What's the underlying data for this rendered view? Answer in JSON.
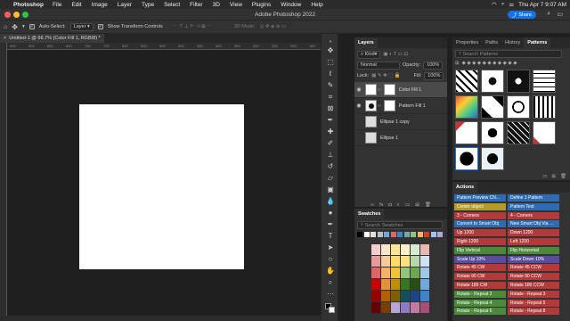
{
  "menubar": {
    "app": "Photoshop",
    "items": [
      "File",
      "Edit",
      "Image",
      "Layer",
      "Type",
      "Select",
      "Filter",
      "3D",
      "View",
      "Plugins",
      "Window",
      "Help"
    ],
    "datetime": "Thu Apr 7  9:07 AM"
  },
  "window": {
    "title": "Adobe Photoshop 2022",
    "share_label": "Share"
  },
  "options": {
    "auto_select_label": "Auto-Select:",
    "auto_select_value": "Layer",
    "show_transform_label": "Show Transform Controls",
    "mode_3d": "3D Mode:"
  },
  "document": {
    "tab_title": "Untitled-1 @ 66.7% (Color Fill 1, RGB/8) *"
  },
  "ruler": {
    "ticks": [
      "950",
      "900",
      "850",
      "800",
      "750",
      "700",
      "650",
      "600",
      "550",
      "500",
      "450",
      "400",
      "350",
      "300",
      "250",
      "200",
      "150"
    ]
  },
  "layers_panel": {
    "tabs": [
      "Layers",
      "Channels",
      "Paths"
    ],
    "kind_label": "Kind",
    "blend_mode": "Normal",
    "opacity_label": "Opacity:",
    "opacity_value": "100%",
    "lock_label": "Lock:",
    "fill_label": "Fill:",
    "fill_value": "100%",
    "layers": [
      {
        "name": "Color Fill 1",
        "visible": true
      },
      {
        "name": "Pattern Fill 1",
        "visible": true
      },
      {
        "name": "Ellipse 1 copy",
        "visible": false
      },
      {
        "name": "Ellipse 1",
        "visible": false
      }
    ]
  },
  "swatches_panel": {
    "title": "Swatches",
    "search_placeholder": "Search Swatches",
    "top_row": [
      "#000000",
      "#ffffff",
      "#e0e0e0",
      "#c0c0c0",
      "#6fa8dc",
      "#e06666",
      "#3d85c6",
      "#76a5af",
      "#93c47d",
      "#f6b26b",
      "#cc4125",
      "#a4c2f4",
      "#b4a7d6"
    ],
    "grid": [
      [
        "#f4cccc",
        "#fce5cd",
        "#ffe599",
        "#fff2cc",
        "#d9ead3",
        "#e6b8af"
      ],
      [
        "#ea9999",
        "#f9cb9c",
        "#ffd966",
        "#ffe082",
        "#b6d7a8",
        "#cfe2f3"
      ],
      [
        "#e06666",
        "#f6b26b",
        "#f1c232",
        "#93c47d",
        "#6aa84f",
        "#9fc5e8"
      ],
      [
        "#cc0000",
        "#e69138",
        "#bf9000",
        "#38761d",
        "#274e13",
        "#6fa8dc"
      ],
      [
        "#990000",
        "#b45f06",
        "#7f6000",
        "#134f5c",
        "#1c4587",
        "#3d85c6"
      ],
      [
        "#660000",
        "#783f04",
        "#b4a7d6",
        "#8e7cc3",
        "#c27ba0",
        "#a64d79"
      ]
    ]
  },
  "patterns_panel": {
    "tabs": [
      "Properties",
      "Paths",
      "History",
      "Patterns"
    ],
    "search_placeholder": "Search Patterns"
  },
  "actions_panel": {
    "title": "Actions",
    "items": [
      {
        "label": "Pattern Preview CN...",
        "color": "#2e6bb0"
      },
      {
        "label": "Define 1 Pattern",
        "color": "#2e6bb0"
      },
      {
        "label": "Center object",
        "color": "#b39a2a"
      },
      {
        "label": "Pattern Test",
        "color": "#2e6bb0"
      },
      {
        "label": "3 - Corners",
        "color": "#b33a3a"
      },
      {
        "label": "4 - Corners",
        "color": "#b33a3a"
      },
      {
        "label": "Convert to Smart Obj",
        "color": "#2e6bb0"
      },
      {
        "label": "New Smart Obj Via ...",
        "color": "#2e6bb0"
      },
      {
        "label": "Up 1200",
        "color": "#b33a3a"
      },
      {
        "label": "Down 1200",
        "color": "#b33a3a"
      },
      {
        "label": "Right 1200",
        "color": "#b33a3a"
      },
      {
        "label": "Left 1200",
        "color": "#b33a3a"
      },
      {
        "label": "Flip Vertical",
        "color": "#4a8a3a"
      },
      {
        "label": "Flip Horizontal",
        "color": "#4a8a3a"
      },
      {
        "label": "Scale Up 10%",
        "color": "#5a4ba0"
      },
      {
        "label": "Scale Down 10%",
        "color": "#5a4ba0"
      },
      {
        "label": "Rotate 45 CW",
        "color": "#b33a3a"
      },
      {
        "label": "Rotate 45 CCW",
        "color": "#b33a3a"
      },
      {
        "label": "Rotate 90 CW",
        "color": "#b33a3a"
      },
      {
        "label": "Rotate 90 CCW",
        "color": "#b33a3a"
      },
      {
        "label": "Rotate 180 CW",
        "color": "#b33a3a"
      },
      {
        "label": "Rotate 180 CCW",
        "color": "#b33a3a"
      },
      {
        "label": "Rotate - Repeat 2",
        "color": "#4a8a3a"
      },
      {
        "label": "Rotate - Repeat 3",
        "color": "#b33a3a"
      },
      {
        "label": "Rotate - Repeat 4",
        "color": "#4a8a3a"
      },
      {
        "label": "Rotate - Repeat 5",
        "color": "#b33a3a"
      },
      {
        "label": "Rotate - Repeat 6",
        "color": "#4a8a3a"
      },
      {
        "label": "Rotate - Repeat 8",
        "color": "#b33a3a"
      }
    ]
  }
}
